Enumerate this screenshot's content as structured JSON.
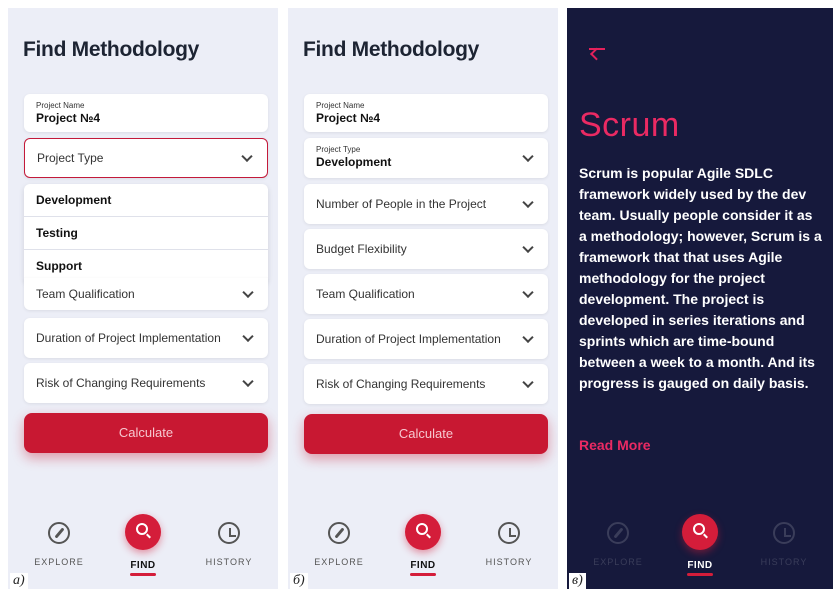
{
  "screen_a": {
    "title": "Find Methodology",
    "project_name": {
      "label": "Project Name",
      "value": "Project №4"
    },
    "project_type_placeholder": "Project Type",
    "dropdown_options": [
      "Development",
      "Testing",
      "Support"
    ],
    "fields": [
      "Team Qualification",
      "Duration of Project Implementation",
      "Risk of Changing Requirements"
    ],
    "calculate": "Calculate",
    "panel_label": "a)"
  },
  "screen_b": {
    "title": "Find Methodology",
    "project_name": {
      "label": "Project Name",
      "value": "Project №4"
    },
    "project_type": {
      "label": "Project Type",
      "value": "Development"
    },
    "fields": [
      "Number of People in the Project",
      "Budget Flexibility",
      "Team Qualification",
      "Duration of Project Implementation",
      "Risk of Changing Requirements"
    ],
    "calculate": "Calculate",
    "panel_label": "б)"
  },
  "screen_c": {
    "title": "Scrum",
    "description": "Scrum is  popular Agile SDLC framework widely used by the dev team. Usually people consider it as a methodology; however, Scrum is a framework that that uses Agile methodology for the project development. The project is developed in series iterations and sprints which are time-bound between a week to a month. And its progress is gauged on daily basis.",
    "read_more": "Read More",
    "panel_label": "в)"
  },
  "nav": {
    "explore": "EXPLORE",
    "find": "FIND",
    "history": "HISTORY"
  },
  "colors": {
    "accent": "#d41d3a",
    "dark_bg": "#16193c",
    "light_bg": "#eceef7",
    "scrum_pink": "#ea2a63"
  },
  "icons": [
    "compass-icon",
    "search-icon",
    "alarm-clock-icon",
    "back-arrow-icon",
    "chevron-down-icon"
  ]
}
